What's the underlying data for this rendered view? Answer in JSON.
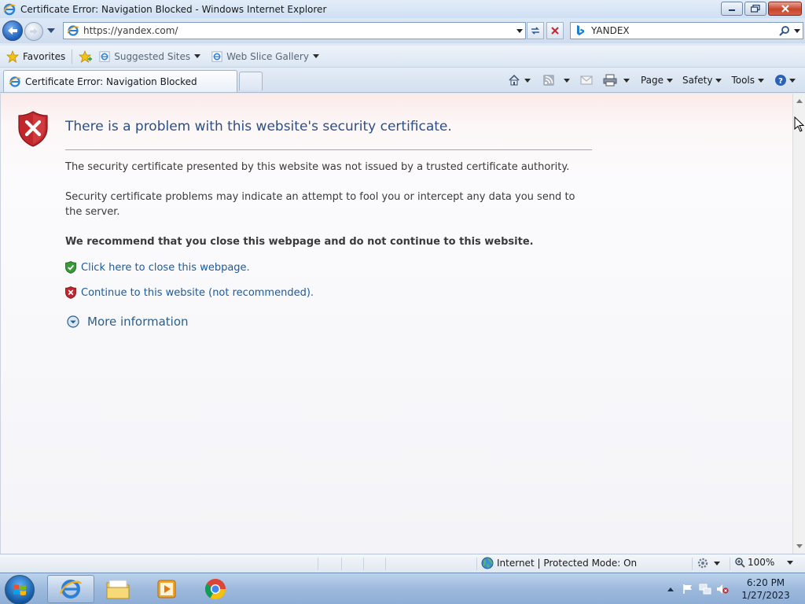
{
  "window": {
    "title": "Certificate Error: Navigation Blocked - Windows Internet Explorer"
  },
  "nav": {
    "url": "https://yandex.com/",
    "search_text": "YANDEX"
  },
  "favorites_bar": {
    "favorites_label": "Favorites",
    "suggested_sites_label": "Suggested Sites",
    "web_slice_gallery_label": "Web Slice Gallery"
  },
  "tabs": [
    {
      "label": "Certificate Error: Navigation Blocked"
    }
  ],
  "commandbar": {
    "page_label": "Page",
    "safety_label": "Safety",
    "tools_label": "Tools"
  },
  "content": {
    "heading": "There is a problem with this website's security certificate.",
    "para1": "The security certificate presented by this website was not issued by a trusted certificate authority.",
    "para2": "Security certificate problems may indicate an attempt to fool you or intercept any data you send to the server.",
    "recommendation": "We recommend that you close this webpage and do not continue to this website.",
    "close_link": "Click here to close this webpage.",
    "continue_link": "Continue to this website (not recommended).",
    "more_info": "More information"
  },
  "statusbar": {
    "zone": "Internet | Protected Mode: On",
    "zoom": "100%"
  },
  "taskbar": {
    "time": "6:20 PM",
    "date": "1/27/2023"
  },
  "colors": {
    "heading": "#2a4f8a",
    "link": "#1a5a9e",
    "error_red": "#c0262c",
    "safe_green": "#3a9a3a"
  }
}
